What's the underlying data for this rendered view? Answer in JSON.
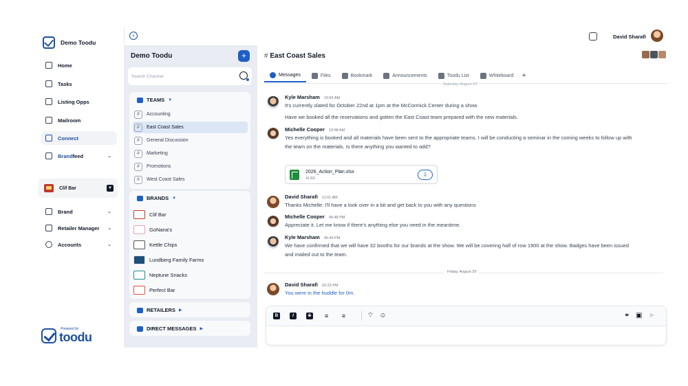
{
  "app": {
    "workspace": "Demo Toodu",
    "user": "David Sharafi"
  },
  "nav": {
    "items": [
      {
        "label": "Home"
      },
      {
        "label": "Tasks"
      },
      {
        "label": "Listing Opps"
      },
      {
        "label": "Mailroom"
      },
      {
        "label": "Connect"
      },
      {
        "label_a": "Brand",
        "label_b": "feed"
      }
    ],
    "selected_brand": "Clif Bar",
    "lower_items": [
      {
        "label": "Brand"
      },
      {
        "label": "Retailer Manager"
      },
      {
        "label": "Accounts"
      }
    ],
    "powered_by": "Powered by",
    "powered_brand": "toodu"
  },
  "channels": {
    "title": "Demo Toodu",
    "add_label": "+",
    "search_placeholder": "Search Channel",
    "teams_label": "TEAMS",
    "teams": [
      {
        "label": "Accounting"
      },
      {
        "label": "East Coast Sales"
      },
      {
        "label": "General Discussion"
      },
      {
        "label": "Marketing"
      },
      {
        "label": "Promotions"
      },
      {
        "label": "West Coast Sales"
      }
    ],
    "brands_label": "BRANDS",
    "brands": [
      {
        "label": "Clif Bar",
        "color": "#c0392b"
      },
      {
        "label": "GoNana's",
        "color": "#e8a0b0"
      },
      {
        "label": "Kettle Chips",
        "color": "#555555"
      },
      {
        "label": "Lundberg Family Farms",
        "color": "#1f4e79"
      },
      {
        "label": "Neptune Snacks",
        "color": "#1e8e8e"
      },
      {
        "label": "Perfect Bar",
        "color": "#e74c3c"
      }
    ],
    "retailers_label": "RETAILERS",
    "dm_label": "DIRECT MESSAGES"
  },
  "chat": {
    "channel": "East Coast Sales",
    "hash": "#",
    "tabs": [
      {
        "label": "Messages"
      },
      {
        "label": "Files"
      },
      {
        "label": "Bookmark"
      },
      {
        "label": "Announcements"
      },
      {
        "label": "Toodu List"
      },
      {
        "label": "Whiteboard"
      }
    ],
    "add_tab": "+",
    "date_top": "Saturday, August 23",
    "messages": [
      {
        "name": "Kyle Marsham",
        "time": "10:55 AM",
        "text": "It's currently slated for October 22nd at 1pm at the McCormick Center during a show"
      },
      {
        "text": "Have we booked all the reservations and gotten the East Coast team prepared with the new materials."
      },
      {
        "name": "Michelle Cooper",
        "time": "10:58 AM",
        "text_1": "Yes everything is booked and all materials have been sent to the appropriate teams. I will be conducting a seminar in the coming weeks to follow up with",
        "text_2": "the team on the materials. Is there anything you wanted to add?"
      },
      {
        "name": "David Sharafi",
        "time": "11:01 AM",
        "text": "Thanks Michelle. I'll have a look over in a bit and get back to you with any questions"
      },
      {
        "name": "Michelle Cooper",
        "time": "06:48 PM",
        "text": "Appreciate it. Let me know if there's anything else you need in the meantime."
      },
      {
        "name": "Kyle Marsham",
        "time": "06:49 PM",
        "text_1": "We have confirmed that we will have 32 booths for our brands at the show. We will be covering half of row 1900 at the show. Badges have been issued",
        "text_2": "and mailed out to the team."
      },
      {
        "name": "David Sharafi",
        "time": "02:23 PM",
        "text": "You were in the huddle for 0m."
      }
    ],
    "file": {
      "name": "2026_Action_Plan.xlsx",
      "type": "XLSX"
    },
    "date_sep": "Friday, August 29",
    "composer": {
      "bold": "B",
      "italic": "I",
      "strike": "S"
    }
  }
}
